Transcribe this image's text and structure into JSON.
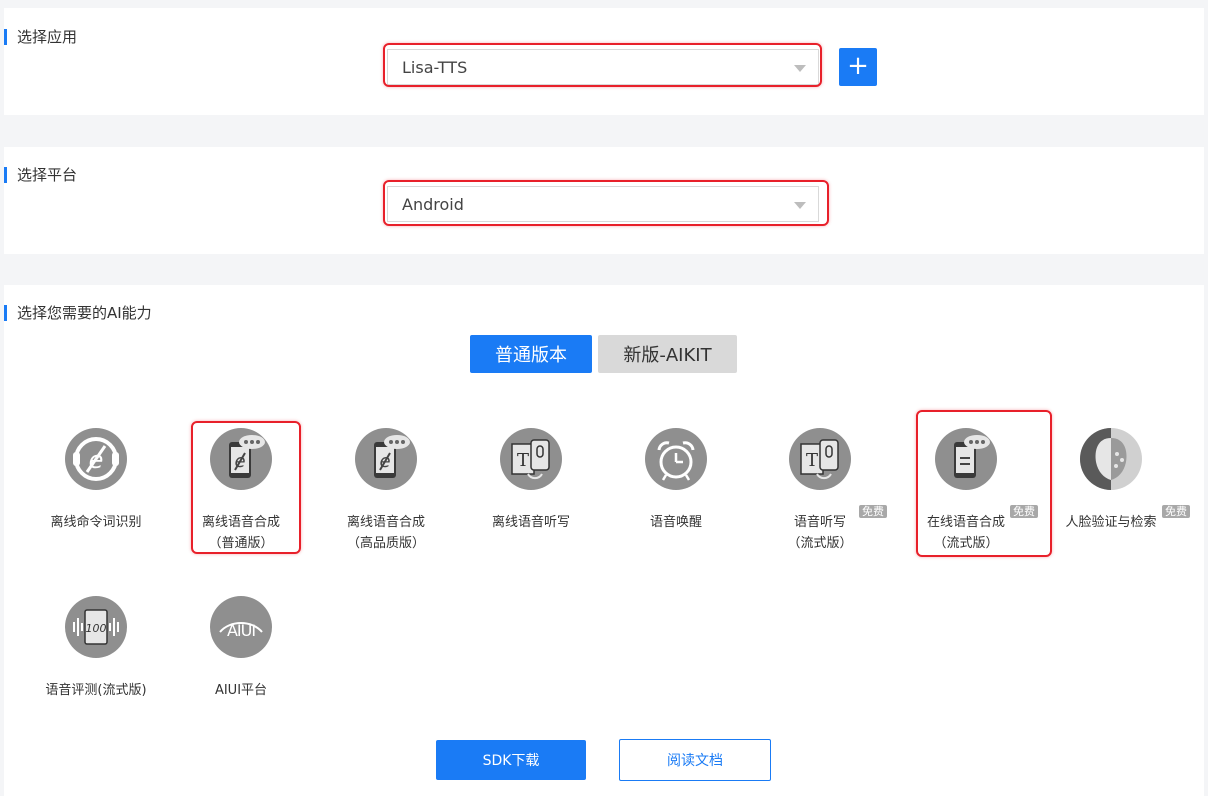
{
  "app_section": {
    "title": "选择应用",
    "selected": "Lisa-TTS",
    "add_label": "+"
  },
  "platform_section": {
    "title": "选择平台",
    "selected": "Android"
  },
  "ability_section": {
    "title": "选择您需要的AI能力",
    "tabs": [
      {
        "label": "普通版本",
        "active": true
      },
      {
        "label": "新版-AIKIT",
        "active": false
      }
    ],
    "items": [
      {
        "label": "离线命令词识别",
        "icon": "offline-command-icon"
      },
      {
        "label": "离线语音合成\n（普通版）",
        "icon": "phone-tts-icon"
      },
      {
        "label": "离线语音合成\n（高品质版）",
        "icon": "phone-tts-hq-icon"
      },
      {
        "label": "离线语音听写",
        "icon": "offline-dictation-icon"
      },
      {
        "label": "语音唤醒",
        "icon": "alarm-clock-icon"
      },
      {
        "label": "语音听写\n（流式版）",
        "icon": "dictation-stream-icon",
        "badge": "免费"
      },
      {
        "label": "在线语音合成\n（流式版）",
        "icon": "online-tts-icon",
        "badge": "免费"
      },
      {
        "label": "人脸验证与检索",
        "icon": "face-verify-icon",
        "badge": "免费"
      },
      {
        "label": "语音评测(流式版)",
        "icon": "speech-eval-icon"
      },
      {
        "label": "AIUI平台",
        "icon": "aiui-icon"
      }
    ]
  },
  "buttons": {
    "download": "SDK下载",
    "docs": "阅读文档"
  },
  "colors": {
    "accent": "#1a7bf5",
    "highlight": "#e8202a",
    "icon_gray": "#8f8f8f"
  }
}
